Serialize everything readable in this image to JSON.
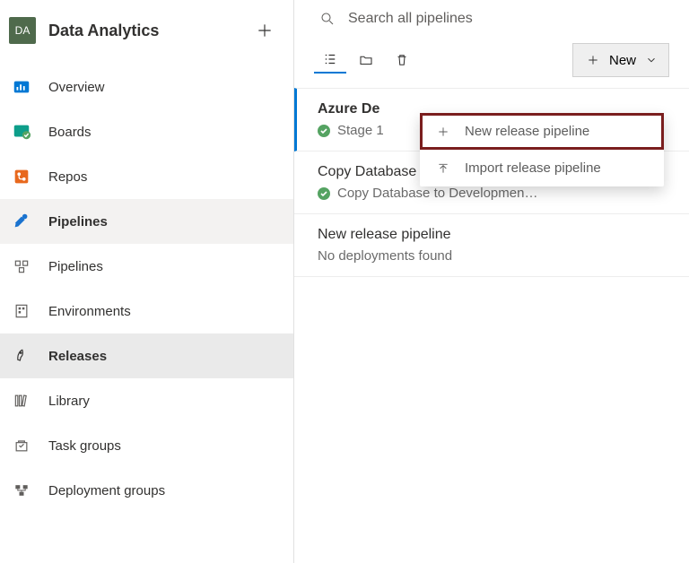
{
  "project": {
    "initials": "DA",
    "name": "Data Analytics"
  },
  "sidebar": {
    "items": [
      {
        "label": "Overview"
      },
      {
        "label": "Boards"
      },
      {
        "label": "Repos"
      },
      {
        "label": "Pipelines"
      }
    ],
    "subitems": [
      {
        "label": "Pipelines"
      },
      {
        "label": "Environments"
      },
      {
        "label": "Releases"
      },
      {
        "label": "Library"
      },
      {
        "label": "Task groups"
      },
      {
        "label": "Deployment groups"
      }
    ]
  },
  "search": {
    "placeholder": "Search all pipelines"
  },
  "toolbar": {
    "new_label": "New"
  },
  "dropdown": {
    "items": [
      {
        "label": "New release pipeline"
      },
      {
        "label": "Import release pipeline"
      }
    ]
  },
  "pipelines": [
    {
      "title": "Azure De",
      "sub": "Stage 1",
      "status": "success"
    },
    {
      "title": "Copy Database Multiple Environ…",
      "sub": "Copy Database to Developmen…",
      "status": "success"
    },
    {
      "title": "New release pipeline",
      "sub": "No deployments found",
      "status": "none"
    }
  ]
}
